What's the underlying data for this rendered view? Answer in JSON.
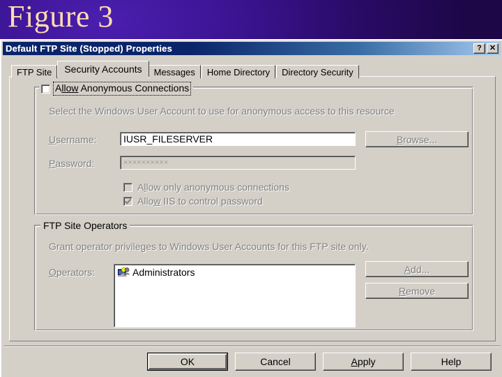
{
  "slide": {
    "title": "Figure 3"
  },
  "dialog": {
    "titlebar": {
      "text": "Default FTP Site (Stopped) Properties",
      "help_button": "?",
      "close_button": "✕"
    },
    "tabs": [
      {
        "label": "FTP Site",
        "active": false
      },
      {
        "label": "Security Accounts",
        "active": true
      },
      {
        "label": "Messages",
        "active": false
      },
      {
        "label": "Home Directory",
        "active": false
      },
      {
        "label": "Directory Security",
        "active": false
      }
    ],
    "anonymous_group": {
      "checkbox_label_pre": "A",
      "checkbox_label_accel": "llow",
      "checkbox_label_post": " Anonymous Connections",
      "checkbox_label_full": "Allow Anonymous Connections",
      "checked": false,
      "description": "Select the Windows User Account to use for anonymous access to this resource",
      "username_label": "Username:",
      "username_label_accel": "U",
      "username_label_rest": "sername:",
      "username_value": "IUSR_FILESERVER",
      "password_label_accel": "P",
      "password_label_rest": "assword:",
      "password_label": "Password:",
      "password_value": "××××××××××",
      "browse_button": "Browse...",
      "browse_button_accel": "B",
      "browse_button_rest": "rowse...",
      "only_anonymous": {
        "label_pre": "A",
        "label_accel": "l",
        "label_post": "low only anonymous connections",
        "label_full": "Allow only anonymous connections",
        "checked": false
      },
      "iis_control_password": {
        "label_pre": "Allo",
        "label_accel": "w",
        "label_post": " IIS to control password",
        "label_full": "Allow IIS to control password",
        "checked": true
      }
    },
    "operators_group": {
      "legend": "FTP Site Operators",
      "description": "Grant operator privileges to Windows User Accounts for this FTP site only.",
      "operators_label": "Operators:",
      "operators_label_accel": "O",
      "operators_label_rest": "perators:",
      "items": [
        {
          "name": "Administrators",
          "icon": "local-group-icon"
        }
      ],
      "add_button": "Add...",
      "add_button_accel": "A",
      "add_button_rest": "dd...",
      "remove_button": "Remove",
      "remove_button_accel": "R",
      "remove_button_rest": "emove"
    },
    "footer_buttons": [
      {
        "label": "OK",
        "default": true,
        "enabled": true
      },
      {
        "label": "Cancel",
        "default": false,
        "enabled": true
      },
      {
        "label": "Apply",
        "default": false,
        "enabled": true,
        "accel": "A",
        "rest": "pply"
      },
      {
        "label": "Help",
        "default": false,
        "enabled": true
      }
    ]
  },
  "colors": {
    "slide_bg_dark": "#1d0747",
    "slide_bg_light": "#4b1fb0",
    "slide_title": "#ffdcb0",
    "titlebar_start": "#0a246a",
    "titlebar_end": "#a6caf0",
    "dialog_face": "#d4d0c8",
    "disabled_text": "#808080",
    "enabled_text": "#000000"
  }
}
